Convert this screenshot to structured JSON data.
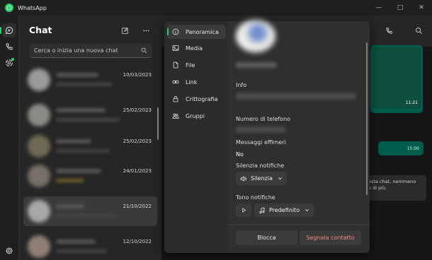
{
  "app": {
    "title": "WhatsApp",
    "accent": "#25d366"
  },
  "window_controls": {
    "minimize": "—",
    "maximize": "□",
    "close": "✕"
  },
  "rail": {
    "icons": [
      "chats-icon",
      "calls-icon",
      "status-icon",
      "settings-icon"
    ]
  },
  "chatlist": {
    "title": "Chat",
    "search_placeholder": "Cerca o inizia una nuova chat",
    "items": [
      {
        "date": "10/03/2023"
      },
      {
        "date": "25/02/2023"
      },
      {
        "date": "25/02/2023"
      },
      {
        "date": "24/01/2023"
      },
      {
        "date": "21/10/2022"
      },
      {
        "date": "12/10/2022"
      }
    ]
  },
  "info_panel": {
    "nav": [
      {
        "label": "Panoramica",
        "icon": "info-icon"
      },
      {
        "label": "Media",
        "icon": "image-icon"
      },
      {
        "label": "File",
        "icon": "file-icon"
      },
      {
        "label": "Link",
        "icon": "link-icon"
      },
      {
        "label": "Crittografia",
        "icon": "lock-icon"
      },
      {
        "label": "Gruppi",
        "icon": "group-icon"
      }
    ],
    "info_label": "Info",
    "phone_label": "Numero di telefono",
    "ephemeral_label": "Messaggi effimeri",
    "ephemeral_value": "No",
    "mute_label": "Silenzia notifiche",
    "mute_button": "Silenzia",
    "tone_label": "Tono notifiche",
    "tone_button": "Predefinito",
    "block_button": "Blocca",
    "report_button": "Segnala contatto",
    "report_color": "#f28b82"
  },
  "conversation": {
    "media_time": "11:21",
    "out_time": "15:00",
    "system_note": [
      "esta chat, nemmeno",
      "e di più."
    ]
  }
}
